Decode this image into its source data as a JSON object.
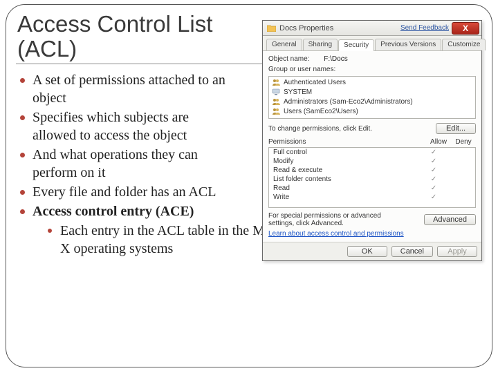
{
  "slide": {
    "title": "Access Control List (ACL)",
    "bullets": [
      "A set of  permissions attached to an object",
      "Specifies which subjects are allowed to access the object",
      "And what operations they can perform on it",
      "Every file and folder has an ACL",
      "Access control entry (ACE)"
    ],
    "sub_bullet": "Each entry in the ACL table in the Microsoft Windows, Linux, and Mac OS X operating systems"
  },
  "dialog": {
    "title": "Docs Properties",
    "feedback": "Send Feedback",
    "close": "X",
    "tabs": [
      "General",
      "Sharing",
      "Security",
      "Previous Versions",
      "Customize"
    ],
    "active_tab": "Security",
    "object_name_label": "Object name:",
    "object_name_value": "F:\\Docs",
    "group_label": "Group or user names:",
    "groups": [
      "Authenticated Users",
      "SYSTEM",
      "Administrators (Sam-Eco2\\Administrators)",
      "Users (SamEco2\\Users)"
    ],
    "edit_text": "To change permissions, click Edit.",
    "edit_btn": "Edit...",
    "perm_label": "Permissions",
    "allow": "Allow",
    "deny": "Deny",
    "permissions": [
      "Full control",
      "Modify",
      "Read & execute",
      "List folder contents",
      "Read",
      "Write"
    ],
    "adv_text": "For special permissions or advanced settings, click Advanced.",
    "adv_btn": "Advanced",
    "learn_link": "Learn about access control and permissions",
    "ok": "OK",
    "cancel": "Cancel",
    "apply": "Apply"
  }
}
